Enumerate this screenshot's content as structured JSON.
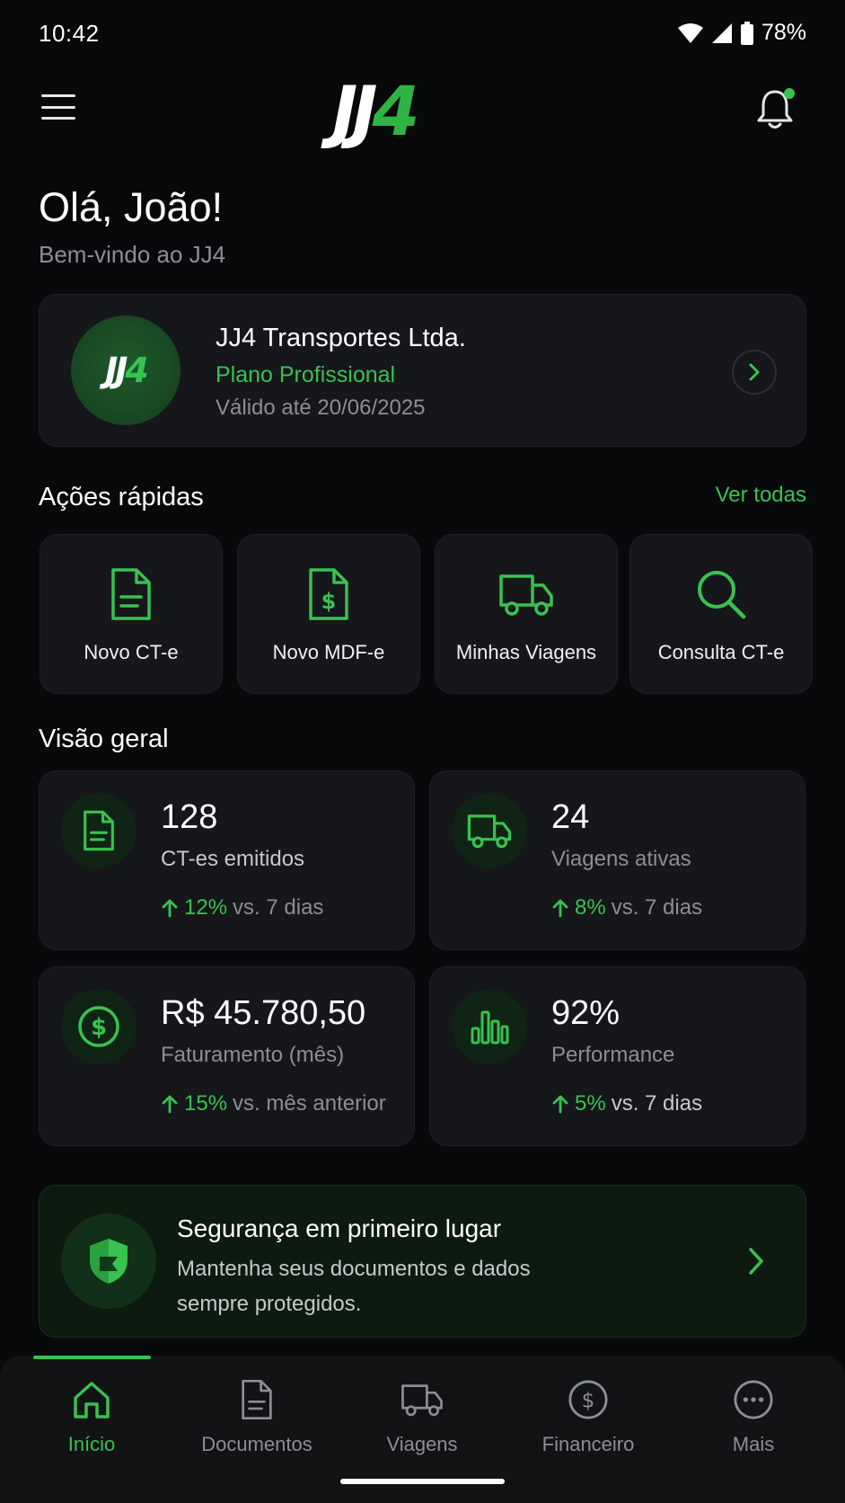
{
  "status_bar": {
    "time": "10:42",
    "battery": "78%"
  },
  "header": {
    "logo_white": "JJ",
    "logo_green": "4",
    "notification_dot": true
  },
  "greeting": {
    "title": "Olá, João!",
    "subtitle": "Bem-vindo ao JJ4"
  },
  "company": {
    "avatar_white": "JJ",
    "avatar_green": "4",
    "name": "JJ4 Transportes Ltda.",
    "plan": "Plano Profissional",
    "valid": "Válido até 20/06/2025"
  },
  "quick_actions": {
    "title": "Ações rápidas",
    "see_all": "Ver todas",
    "items": [
      {
        "label": "Novo CT-e",
        "icon": "document-icon"
      },
      {
        "label": "Novo MDF-e",
        "icon": "dollar-document-icon"
      },
      {
        "label": "Minhas Viagens",
        "icon": "truck-icon"
      },
      {
        "label": "Consulta CT-e",
        "icon": "search-icon"
      }
    ]
  },
  "overview": {
    "title": "Visão geral",
    "stats": [
      {
        "value": "128",
        "label": "CT-es emitidos",
        "pct": "12%",
        "compare": "vs. 7 dias",
        "icon": "document-icon"
      },
      {
        "value": "24",
        "label": "Viagens ativas",
        "pct": "8%",
        "compare": "vs. 7 dias",
        "icon": "truck-icon"
      },
      {
        "value": "R$ 45.780,50",
        "label": "Faturamento (mês)",
        "pct": "15%",
        "compare": "vs. mês anterior",
        "icon": "dollar-circle-icon"
      },
      {
        "value": "92%",
        "label": "Performance",
        "pct": "5%",
        "compare": "vs. 7 dias",
        "icon": "bar-chart-icon"
      }
    ]
  },
  "security": {
    "title": "Segurança em primeiro lugar",
    "line1": "Mantenha seus documentos e dados",
    "line2": "sempre protegidos."
  },
  "bottom_nav": {
    "items": [
      {
        "label": "Início",
        "icon": "home-icon",
        "active": true
      },
      {
        "label": "Documentos",
        "icon": "document-icon",
        "active": false
      },
      {
        "label": "Viagens",
        "icon": "truck-icon",
        "active": false
      },
      {
        "label": "Financeiro",
        "icon": "dollar-circle-icon",
        "active": false
      },
      {
        "label": "Mais",
        "icon": "more-icon",
        "active": false
      }
    ]
  },
  "colors": {
    "accent": "#38c24f",
    "background": "#08090a",
    "card": "#15171a"
  }
}
